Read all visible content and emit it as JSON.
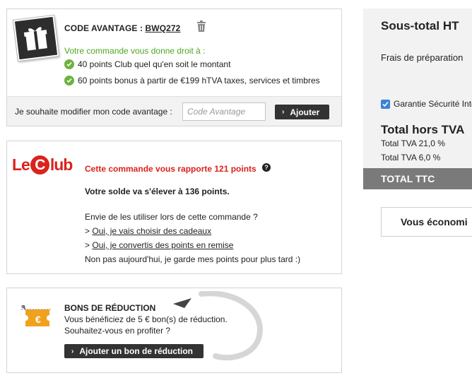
{
  "code_panel": {
    "title_label": "CODE AVANTAGE :",
    "code_value": "BWQ272",
    "intro": "Votre commande vous donne droit à :",
    "benefits": [
      "40 points Club quel qu'en soit le montant",
      "60 points bonus à partir de €199 hTVA taxes, services et timbres"
    ],
    "modify_label": "Je souhaite modifier mon code avantage :",
    "input_placeholder": "Code Avantage",
    "apply_button": "Ajouter"
  },
  "club_panel": {
    "logo_left": "Le",
    "logo_c": "C",
    "logo_right": "lub",
    "headline": "Cette commande vous rapporte 121 points",
    "help": "?",
    "balance": "Votre solde va s'élever à 136 points.",
    "question": "Envie de les utiliser lors de cette commande ?",
    "option1_prefix": ">",
    "option1": "Oui, je vais choisir des cadeaux",
    "option2_prefix": ">",
    "option2": "Oui, je convertis des points en remise",
    "later": "Non pas aujourd'hui, je garde mes points pour plus tard :)"
  },
  "bons_panel": {
    "title": "BONS DE RÉDUCTION",
    "line1": "Vous bénéficiez de 5 € bon(s) de réduction.",
    "line2": "Souhaitez-vous en profiter ?",
    "add_button": "Ajouter un bon de réduction",
    "coupon_symbol": "€"
  },
  "summary": {
    "subtotal": "Sous-total HT",
    "prep_fees": "Frais de préparation",
    "guarantee": "Garantie Sécurité Inte",
    "total_ht": "Total hors TVA",
    "tva1": "Total TVA 21,0 %",
    "tva2": "Total TVA 6,0 %",
    "total_ttc": "TOTAL TTC"
  },
  "economy": {
    "text": "Vous économi"
  },
  "colors": {
    "club_red": "#d9231c",
    "green": "#4aa820",
    "dark_button": "#333333",
    "coupon_orange": "#f0a21e"
  }
}
